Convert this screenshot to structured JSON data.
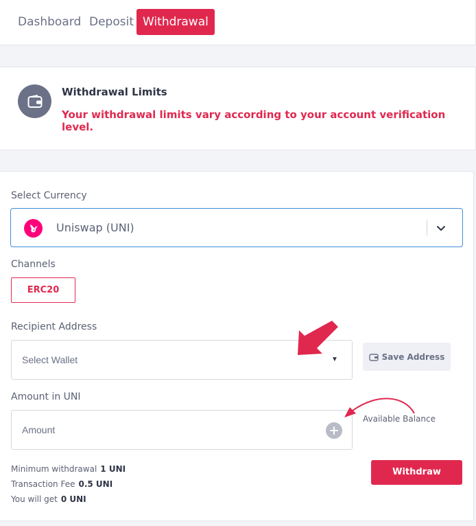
{
  "tabs": [
    {
      "label": "Dashboard"
    },
    {
      "label": "Deposit"
    },
    {
      "label": "Withdrawal",
      "active": true
    }
  ],
  "limits": {
    "icon": "wallet-icon",
    "title": "Withdrawal Limits",
    "text": "Your withdrawal limits vary according to your account verification level."
  },
  "form": {
    "currency_label": "Select Currency",
    "currency_value": "Uniswap (UNI)",
    "currency_icon": "uniswap-logo",
    "channels_label": "Channels",
    "channel": "ERC20",
    "recipient_label": "Recipient Address",
    "wallet_placeholder": "Select Wallet",
    "save_address": "Save Address",
    "amount_label": "Amount in UNI",
    "amount_placeholder": "Amount",
    "available_balance": "Available Balance",
    "withdraw": "Withdraw",
    "info": [
      {
        "label": "Minimum withdrawal",
        "value": "1 UNI"
      },
      {
        "label": "Transaction Fee",
        "value": "0.5 UNI"
      },
      {
        "label": "You will get",
        "value": "0 UNI"
      }
    ]
  },
  "colors": {
    "accent": "#e0284f",
    "focus_border": "#3f8ed8",
    "uniswap_pink": "#ff007a"
  }
}
